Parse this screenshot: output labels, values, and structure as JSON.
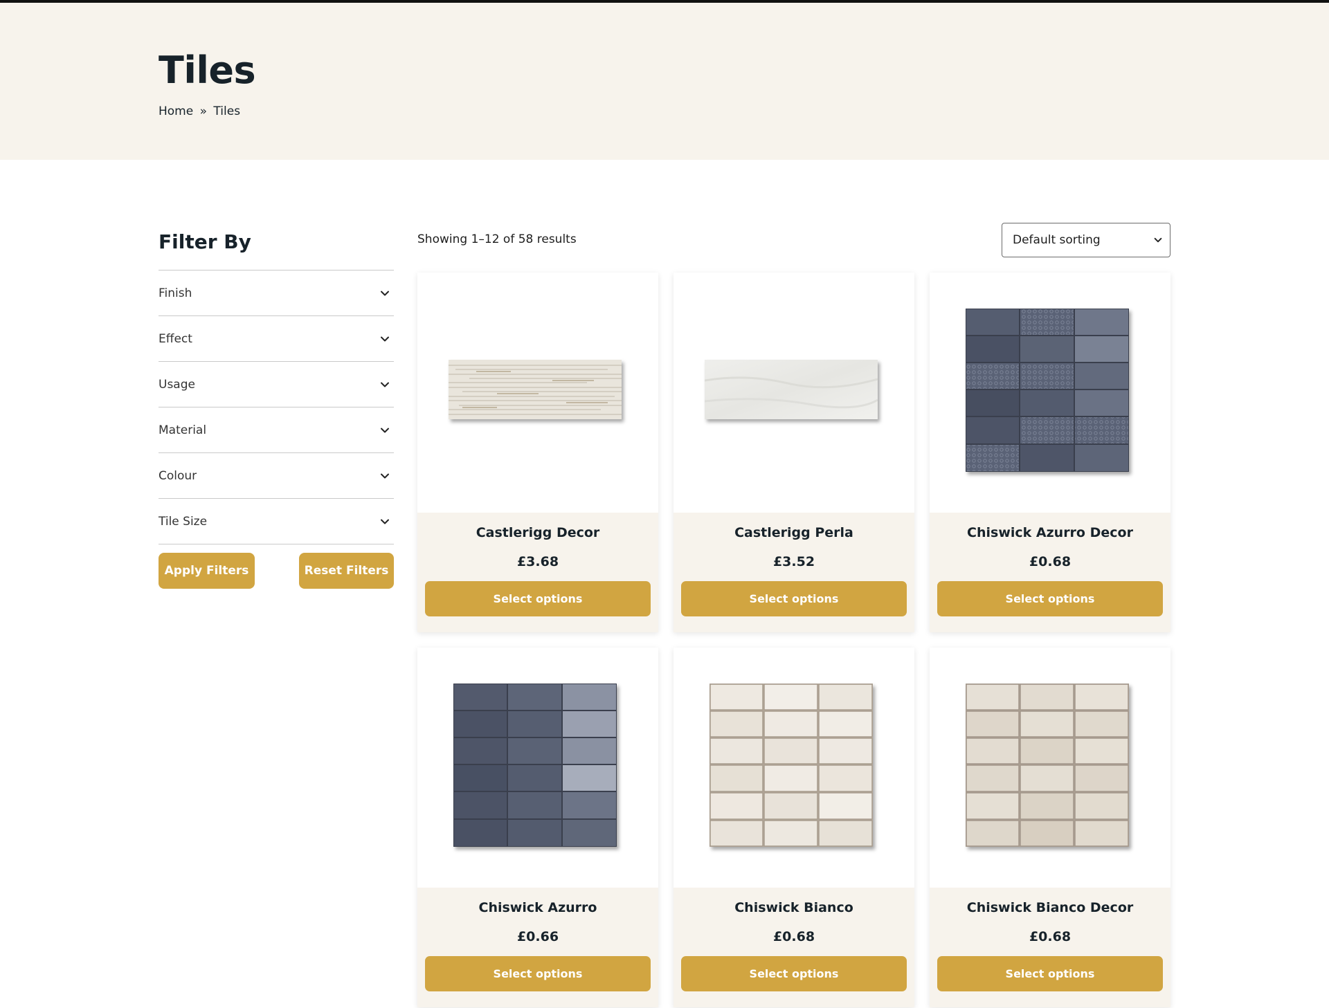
{
  "page": {
    "title": "Tiles",
    "breadcrumb": [
      "Home",
      "»",
      "Tiles"
    ]
  },
  "sidebar": {
    "title": "Filter By",
    "filters": [
      "Finish",
      "Effect",
      "Usage",
      "Material",
      "Colour",
      "Tile Size"
    ],
    "apply_label": "Apply Filters",
    "reset_label": "Reset Filters"
  },
  "toolbar": {
    "result_count": "Showing 1–12 of 58 results",
    "sort_selected": "Default sorting"
  },
  "products": [
    {
      "name": "Castlerigg Decor",
      "price": "£3.68",
      "button": "Select options"
    },
    {
      "name": "Castlerigg Perla",
      "price": "£3.52",
      "button": "Select options"
    },
    {
      "name": "Chiswick Azurro Decor",
      "price": "£0.68",
      "button": "Select options"
    },
    {
      "name": "Chiswick Azurro",
      "price": "£0.66",
      "button": "Select options"
    },
    {
      "name": "Chiswick Bianco",
      "price": "£0.68",
      "button": "Select options"
    },
    {
      "name": "Chiswick Bianco Decor",
      "price": "£0.68",
      "button": "Select options"
    }
  ],
  "colors": {
    "accent": "#d1a541",
    "hero_bg": "#f7f3ec",
    "text": "#17222a"
  },
  "icons": {
    "filter_toggle": "chevron-down-icon",
    "sort_toggle": "chevron-down-icon"
  }
}
